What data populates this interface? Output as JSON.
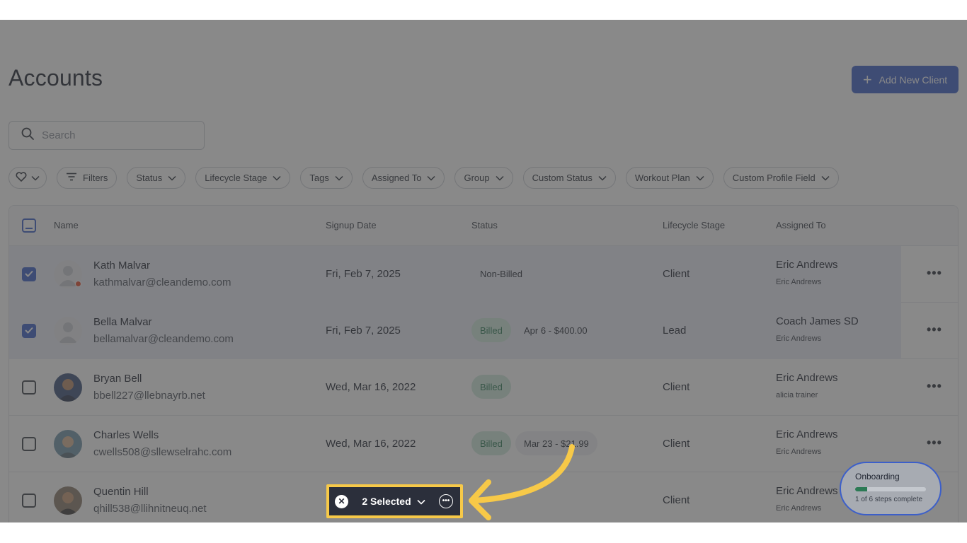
{
  "page": {
    "title": "Accounts"
  },
  "header": {
    "add_button_label": "Add New Client"
  },
  "search": {
    "placeholder": "Search"
  },
  "filters": {
    "filters_label": "Filters",
    "chips": [
      "Status",
      "Lifecycle Stage",
      "Tags",
      "Assigned To",
      "Group",
      "Custom Status",
      "Workout Plan",
      "Custom Profile Field"
    ]
  },
  "table": {
    "columns": {
      "name": "Name",
      "signup_date": "Signup Date",
      "status": "Status",
      "lifecycle_stage": "Lifecycle Stage",
      "assigned_to": "Assigned To"
    },
    "rows": [
      {
        "name": "Kath Malvar",
        "email": "kathmalvar@cleandemo.com",
        "signup": "Fri, Feb 7, 2025",
        "status": "Non-Billed",
        "status_extra": "",
        "stage": "Client",
        "assigned": "Eric Andrews",
        "assigned_sub": "Eric Andrews",
        "selected": true
      },
      {
        "name": "Bella Malvar",
        "email": "bellamalvar@cleandemo.com",
        "signup": "Fri, Feb 7, 2025",
        "status": "Billed",
        "status_extra": "Apr 6 - $400.00",
        "stage": "Lead",
        "assigned": "Coach James SD",
        "assigned_sub": "Eric Andrews",
        "selected": true
      },
      {
        "name": "Bryan Bell",
        "email": "bbell227@llebnayrb.net",
        "signup": "Wed, Mar 16, 2022",
        "status": "Billed",
        "status_extra": "",
        "stage": "Client",
        "assigned": "Eric Andrews",
        "assigned_sub": "alicia trainer",
        "selected": false
      },
      {
        "name": "Charles Wells",
        "email": "cwells508@sllewselrahc.com",
        "signup": "Wed, Mar 16, 2022",
        "status": "Billed",
        "status_extra": "Mar 23 - $21.99",
        "stage": "Client",
        "assigned": "Eric Andrews",
        "assigned_sub": "Eric Andrews",
        "selected": false
      },
      {
        "name": "Quentin Hill",
        "email": "qhill538@llihnitneuq.net",
        "signup": "",
        "status": "",
        "status_extra": "",
        "stage": "Client",
        "assigned": "Eric Andrews",
        "assigned_sub": "Eric Andrews",
        "selected": false
      }
    ]
  },
  "selection_bar": {
    "label": "2 Selected"
  },
  "onboarding": {
    "title": "Onboarding",
    "steps_text": "1 of 6 steps complete",
    "progress": 0.1667
  },
  "colors": {
    "accent": "#3c5fc9",
    "billed_bg": "#cfe9dd",
    "billed_text": "#2b7a55",
    "highlight": "#f7c948"
  },
  "icons": [
    "search-icon",
    "heart-icon",
    "chevron-down-icon",
    "filter-lines-icon",
    "plus-icon",
    "close-icon",
    "more-horizontal-icon",
    "check-icon",
    "minus-icon",
    "arrow-pointer-icon"
  ]
}
